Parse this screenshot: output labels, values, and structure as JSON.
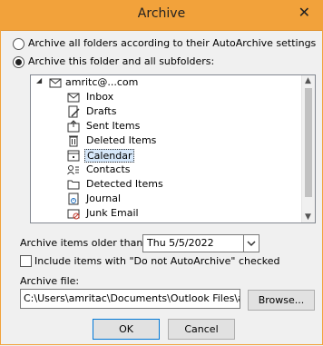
{
  "window": {
    "title": "Archive",
    "close_label": "✕"
  },
  "options": {
    "archive_all_label": "Archive all folders according to their AutoArchive settings",
    "archive_all_selected": false,
    "archive_this_label": "Archive this folder and all subfolders:",
    "archive_this_selected": true
  },
  "tree": {
    "root": {
      "label": "amritc@...com",
      "expander": "◢"
    },
    "items": [
      {
        "label": "Inbox",
        "icon": "inbox-icon"
      },
      {
        "label": "Drafts",
        "icon": "drafts-icon"
      },
      {
        "label": "Sent Items",
        "icon": "sent-items-icon"
      },
      {
        "label": "Deleted Items",
        "icon": "deleted-items-icon"
      },
      {
        "label": "Calendar",
        "icon": "calendar-icon",
        "selected": true
      },
      {
        "label": "Contacts",
        "icon": "contacts-icon"
      },
      {
        "label": "Detected Items",
        "icon": "folder-icon"
      },
      {
        "label": "Journal",
        "icon": "journal-icon"
      },
      {
        "label": "Junk Email",
        "icon": "junk-email-icon"
      }
    ]
  },
  "older_than": {
    "label": "Archive items older than:",
    "value": "Thu 5/5/2022"
  },
  "include": {
    "label": "Include items with \"Do not AutoArchive\" checked",
    "checked": false
  },
  "archive_file": {
    "label": "Archive file:",
    "value": "C:\\Users\\amritac\\Documents\\Outlook Files\\arc"
  },
  "buttons": {
    "browse": "Browse...",
    "ok": "OK",
    "cancel": "Cancel"
  }
}
